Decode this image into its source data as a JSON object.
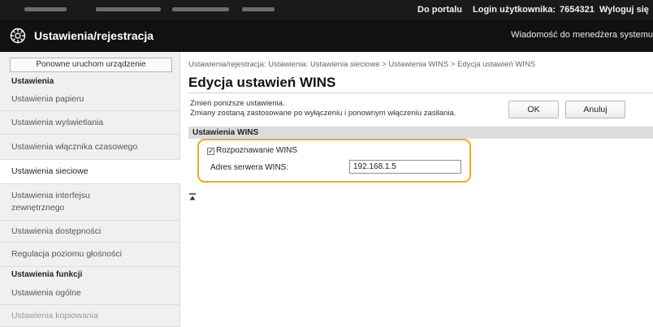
{
  "topbar": {
    "portal_link": "Do portalu",
    "login_label": "Login użytkownika:",
    "login_value": "7654321",
    "logout_link": "Wyloguj się"
  },
  "header": {
    "title": "Ustawienia/rejestracja",
    "admin_message": "Wiadomość do menedżera systemu"
  },
  "sidebar": {
    "restart_button": "Ponowne uruchom urządzenie",
    "section_settings": "Ustawienia",
    "items": [
      {
        "label": "Ustawienia papieru"
      },
      {
        "label": "Ustawienia wyświetlania"
      },
      {
        "label": "Ustawienia włącznika czasowego"
      },
      {
        "label": "Ustawienia sieciowe"
      },
      {
        "label": "Ustawienia interfejsu zewnętrznego"
      },
      {
        "label": "Ustawienia dostępności"
      },
      {
        "label": "Regulacja poziomu głośności"
      }
    ],
    "section_functions": "Ustawienia funkcji",
    "function_items": [
      {
        "label": "Ustawienia ogólne"
      },
      {
        "label": "Ustawienia kopiowania"
      }
    ]
  },
  "main": {
    "breadcrumb": "Ustawienia/rejestracja: Ustawienia: Ustawienia sieciowe > Ustawienia WINS > Edycja ustawień WINS",
    "page_title": "Edycja ustawień WINS",
    "description_1": "Zmień poniższe ustawienia.",
    "description_2": "Zmiany zostaną zastosowane po wyłączeniu i ponownym włączeniu zasilania.",
    "ok_button": "OK",
    "cancel_button": "Anuluj",
    "section_title": "Ustawienia WINS",
    "wins_checkbox_label": "Rozpoznawanie WINS",
    "wins_checkbox_checked": true,
    "wins_server_label": "Adres serwera WINS:",
    "wins_server_value": "192.168.1.5",
    "highlight_color": "#f5a623"
  }
}
